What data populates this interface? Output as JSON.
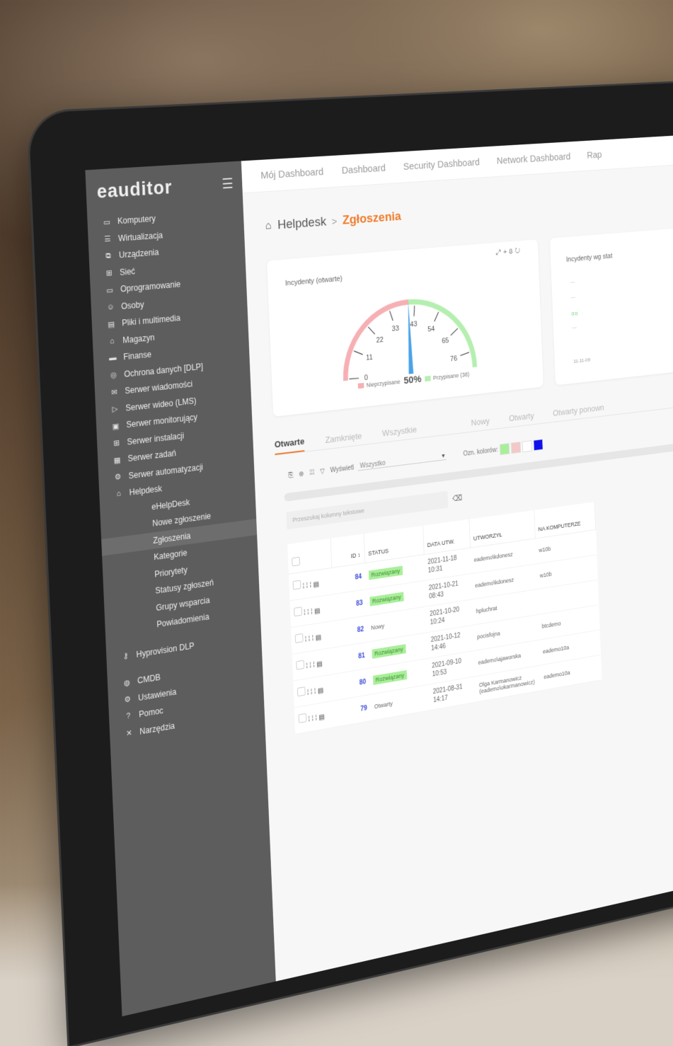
{
  "app": {
    "logo": "eauditor"
  },
  "topbar": {
    "tabs": [
      "Mój Dashboard",
      "Dashboard",
      "Security Dashboard",
      "Network Dashboard",
      "Rap"
    ]
  },
  "sidebar": {
    "items": [
      {
        "label": "Komputery",
        "icon": "monitor-icon"
      },
      {
        "label": "Wirtualizacja",
        "icon": "server-icon"
      },
      {
        "label": "Urządzenia",
        "icon": "devices-icon"
      },
      {
        "label": "Sieć",
        "icon": "network-icon"
      },
      {
        "label": "Oprogramowanie",
        "icon": "software-icon"
      },
      {
        "label": "Osoby",
        "icon": "people-icon"
      },
      {
        "label": "Pliki i multimedia",
        "icon": "files-icon"
      },
      {
        "label": "Magazyn",
        "icon": "warehouse-icon"
      },
      {
        "label": "Finanse",
        "icon": "finance-icon"
      },
      {
        "label": "Ochrona danych [DLP]",
        "icon": "shield-icon"
      },
      {
        "label": "Serwer wiadomości",
        "icon": "mail-icon"
      },
      {
        "label": "Serwer wideo (LMS)",
        "icon": "video-icon"
      },
      {
        "label": "Serwer monitorujący",
        "icon": "monitor-server-icon"
      },
      {
        "label": "Serwer instalacji",
        "icon": "install-icon"
      },
      {
        "label": "Serwer zadań",
        "icon": "tasks-icon"
      },
      {
        "label": "Serwer automatyzacji",
        "icon": "automation-icon"
      },
      {
        "label": "Helpdesk",
        "icon": "helpdesk-icon"
      }
    ],
    "helpdesk_sub": [
      "eHelpDesk",
      "Nowe zgłoszenie",
      "Zgłoszenia",
      "Kategorie",
      "Priorytety",
      "Statusy zgłoszeń",
      "Grupy wsparcia",
      "Powiadomienia"
    ],
    "bottom": [
      {
        "label": "Hyprovision DLP",
        "icon": "user-key-icon"
      },
      {
        "label": "CMDB",
        "icon": "database-icon"
      },
      {
        "label": "Ustawienia",
        "icon": "gear-icon"
      },
      {
        "label": "Pomoc",
        "icon": "help-icon"
      },
      {
        "label": "Narzędzia",
        "icon": "tools-icon"
      }
    ]
  },
  "breadcrumb": {
    "root": "Helpdesk",
    "current": "Zgłoszenia"
  },
  "gauge_card": {
    "title": "Incydenty (otwarte)",
    "ticks": [
      "0",
      "11",
      "22",
      "33",
      "43",
      "54",
      "65",
      "76"
    ],
    "percent": "50%",
    "legend_left": "Nieprzypisane",
    "legend_right": "Przypisane (38)",
    "value_fraction": 0.5
  },
  "status_card": {
    "title": "Incydenty wg stat",
    "green_label": "0-0",
    "date": "11-11-09"
  },
  "status_tabs": {
    "tabs": [
      "Otwarte",
      "Zamknięte",
      "Wszystkie"
    ],
    "filters": [
      "Nowy",
      "Otwarty",
      "Otwarty ponown"
    ]
  },
  "toolbar": {
    "show_label": "Wyświetl",
    "show_value": "Wszystko",
    "colors_label": "Ozn. kolorów:"
  },
  "search": {
    "placeholder": "Przeszukaj kolumny tekstowe"
  },
  "table": {
    "headers": {
      "id": "ID",
      "status": "STATUS",
      "date": "DATA UTW.",
      "created_by": "UTWORZYŁ",
      "computer": "NA KOMPUTERZE"
    },
    "rows": [
      {
        "id": "84",
        "status": "Rozwiązany",
        "date": "2021-11-18",
        "time": "10:31",
        "created_by": "eademo\\kdonesz",
        "computer": "w10b"
      },
      {
        "id": "83",
        "status": "Rozwiązany",
        "date": "2021-10-21",
        "time": "08:43",
        "created_by": "eademo\\kdonesz",
        "computer": "w10b"
      },
      {
        "id": "82",
        "status": "Nowy",
        "date": "2021-10-20",
        "time": "10:24",
        "created_by": "hpluchrat",
        "computer": ""
      },
      {
        "id": "81",
        "status": "Rozwiązany",
        "date": "2021-10-12",
        "time": "14:46",
        "created_by": "pocisfojna",
        "computer": "btcdemo"
      },
      {
        "id": "80",
        "status": "Rozwiązany",
        "date": "2021-09-10",
        "time": "10:53",
        "created_by": "eademo\\ajaworska",
        "computer": "eademo10a"
      },
      {
        "id": "79",
        "status": "Otwarty",
        "date": "2021-08-31",
        "time": "14:17",
        "created_by": "Olga Karmanowicz (eademo\\okarmanowicz)",
        "computer": "eademo10a"
      }
    ]
  },
  "colors": {
    "accent": "#f07b2a",
    "sidebar": "#5d5d5d",
    "badge_green": "#a9ef9a",
    "link_blue": "#3b4cdc"
  }
}
